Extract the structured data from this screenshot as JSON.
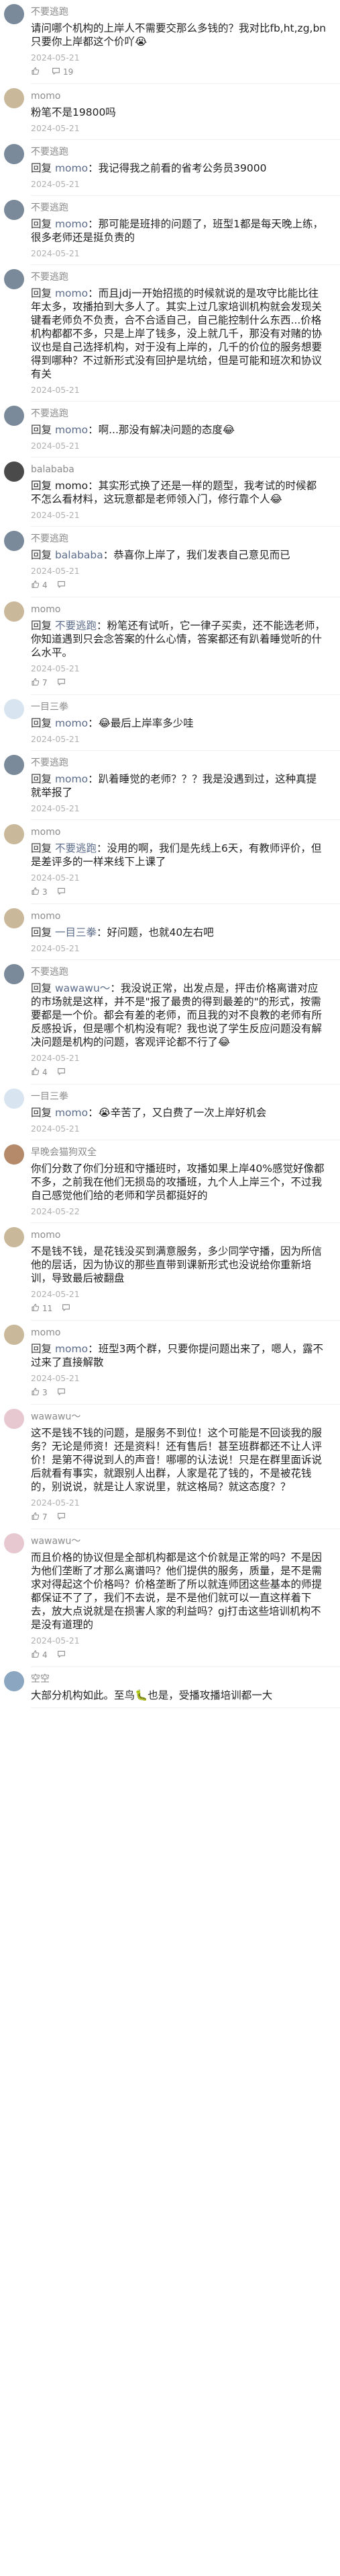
{
  "ui": {
    "comments": [
      {
        "user": "不要逃跑",
        "avatar": "A",
        "content": "请问哪个机构的上岸人不需要交那么多钱的？我对比fb,ht,zg,bn只要你上岸都这个价吖😭",
        "date": "2024-05-21",
        "likes": "",
        "replies": "19",
        "show_actions": true
      },
      {
        "user": "momo",
        "avatar": "B",
        "content": "粉笔不是19800吗",
        "date": "2024-05-21",
        "likes": "",
        "replies": "",
        "show_actions": false
      },
      {
        "user": "不要逃跑",
        "avatar": "A",
        "reply": "回复",
        "mention": "momo",
        "content": "：我记得我之前看的省考公务员39000",
        "date": "2024-05-21",
        "likes": "",
        "replies": "",
        "show_actions": false
      },
      {
        "user": "不要逃跑",
        "avatar": "A",
        "reply": "回复",
        "mention": "momo",
        "content": "：那可能是班排的问题了，班型1都是每天晚上练，很多老师还是挺负责的",
        "date": "2024-05-21",
        "likes": "",
        "replies": "",
        "show_actions": false
      },
      {
        "user": "不要逃跑",
        "avatar": "A",
        "reply": "回复",
        "mention": "momo",
        "content": "：而且jdj一开始招揽的时候就说的是攻守比能比往年太多，攻播拍到大多人了。其实上过几家培训机构就会发现关键看老师负不负责，合不合适自己，自己能控制什么东西...价格机构都都不多，只是上岸了钱多，没上就几千，那没有对赌的协议也是自己选择机构，对于没有上岸的，几千的价位的服务想要得到哪种？不过新形式没有回护是坑给，但是可能和班次和协议有关",
        "date": "2024-05-21",
        "likes": "",
        "replies": "",
        "show_actions": false
      },
      {
        "user": "不要逃跑",
        "avatar": "A",
        "reply": "回复",
        "mention": "momo",
        "content": "：啊...那没有解决问题的态度😂",
        "date": "2024-05-21",
        "likes": "",
        "replies": "",
        "show_actions": false
      },
      {
        "user": "balababa",
        "avatar": "C",
        "content": "回复 momo：其实形式换了还是一样的题型，我考试的时候都不怎么看材料，这玩意都是老师领入门，修行靠个人😂",
        "date": "2024-05-21",
        "likes": "",
        "replies": "",
        "show_actions": false
      },
      {
        "user": "不要逃跑",
        "avatar": "A",
        "reply": "回复",
        "mention": "balababa",
        "content": "：恭喜你上岸了，我们发表自己意见而已",
        "date": "2024-05-21",
        "likes": "4",
        "replies": "",
        "show_actions": true
      },
      {
        "user": "momo",
        "avatar": "B",
        "reply": "回复",
        "mention": "不要逃跑",
        "content": "：粉笔还有试听，它一律子买卖，还不能选老师，你知道遇到只会念答案的什么心情，答案都还有趴着睡觉听的什么水平。",
        "date": "2024-05-21",
        "likes": "7",
        "replies": "",
        "show_actions": true
      },
      {
        "user": "一目三拳",
        "avatar": "D",
        "reply": "回复",
        "mention": "momo",
        "content": "：😂最后上岸率多少哇",
        "date": "2024-05-21",
        "likes": "",
        "replies": "",
        "show_actions": false
      },
      {
        "user": "不要逃跑",
        "avatar": "A",
        "reply": "回复",
        "mention": "momo",
        "content": "：趴着睡觉的老师？？？我是没遇到过，这种真提就举报了",
        "date": "2024-05-21",
        "likes": "",
        "replies": "",
        "show_actions": false
      },
      {
        "user": "momo",
        "avatar": "B",
        "reply": "回复",
        "mention": "不要逃跑",
        "content": "：没用的啊，我们是先线上6天，有教师评价，但是差评多的一样来线下上课了",
        "date": "2024-05-21",
        "likes": "3",
        "replies": "",
        "show_actions": true
      },
      {
        "user": "momo",
        "avatar": "B",
        "reply": "回复",
        "mention": "一目三拳",
        "content": "：好问题，也就40左右吧",
        "date": "2024-05-21",
        "likes": "",
        "replies": "",
        "show_actions": false
      },
      {
        "user": "不要逃跑",
        "avatar": "A",
        "reply": "回复",
        "mention": "wawawu～",
        "content": "：我没说正常，出发点是，抨击价格离谱对应的市场就是这样，并不是\"报了最贵的得到最差的\"的形式，按需要都是一个价。都会有差的老师，而且我的对不良教的老师有所反感投诉，但是哪个机构没有呢？我也说了学生反应问题没有解决问题是机构的问题，客观评论都不行了😂",
        "date": "2024-05-21",
        "likes": "4",
        "replies": "",
        "show_actions": true
      },
      {
        "user": "一目三拳",
        "avatar": "D",
        "reply": "回复",
        "mention": "momo",
        "content": "：😭辛苦了，又白费了一次上岸好机会",
        "date": "2024-05-21",
        "likes": "",
        "replies": "",
        "show_actions": false
      },
      {
        "user": "早晚会猫狗双全",
        "avatar": "E",
        "content": "你们分数了你们分班和守播班时，攻播如果上岸40%感觉好像都不多，之前我在他们无损岛的攻播班，九个人上岸三个，不过我自己感觉他们给的老师和学员都挺好的",
        "date": "2024-05-22",
        "likes": "",
        "replies": "",
        "show_actions": false
      },
      {
        "user": "momo",
        "avatar": "B",
        "content": "不是钱不钱，是花钱没买到满意服务，多少同学守播，因为所信他的层话，因为协议的那些直带到课新形式也没说给你重新培训，导致最后被翻盘",
        "date": "2024-05-21",
        "likes": "11",
        "replies": "",
        "show_actions": true
      },
      {
        "user": "momo",
        "avatar": "B",
        "reply": "回复",
        "mention": "momo",
        "content": "：班型3两个群，只要你提问题出来了，嗯人，露不过来了直接解散",
        "date": "2024-05-21",
        "likes": "3",
        "replies": "",
        "show_actions": true
      },
      {
        "user": "wawawu～",
        "avatar": "F",
        "content": "这不是钱不钱的问题，是服务不到位！这个可能是不回谈我的服务？无论是师资！还是资料！还有售后！甚至班群都还不让人评价！是第不得说到人的声音！哪哪的认法说！只是在群里面诉说后就看有事实，就跟别人出群，人家是花了钱的，不是被花钱的，别说说，就是让人家说里，就这格局？就这态度？？",
        "date": "2024-05-21",
        "likes": "7",
        "replies": "",
        "show_actions": true
      },
      {
        "user": "wawawu～",
        "avatar": "F",
        "content": "而且价格的协议但是全部机构都是这个价就是正常的吗？不是因为他们垄断了才那么离谱吗？他们提供的服务，质量，是不是需求对得起这个价格吗？价格垄断了所以就连师团这些基本的师提都保证不了了，我们不去说，是不是他们就可以一直这样着下去，放大点说就是在损害人家的利益吗？gj打击这些培训机构不是没有道理的",
        "date": "2024-05-21",
        "likes": "4",
        "replies": "",
        "show_actions": true
      },
      {
        "user": "空空",
        "avatar": "G",
        "content": "大部分机构如此。至鸟🐛也是，受播攻播培训都一大",
        "date": "",
        "likes": "",
        "replies": "",
        "show_actions": false
      }
    ],
    "colors": {
      "A": "#7a8a9a",
      "B": "#c9b89a",
      "C": "#4a4a4a",
      "D": "#d8e4f0",
      "E": "#b48a6a",
      "F": "#e8c8d0",
      "G": "#8aa6c0"
    }
  }
}
